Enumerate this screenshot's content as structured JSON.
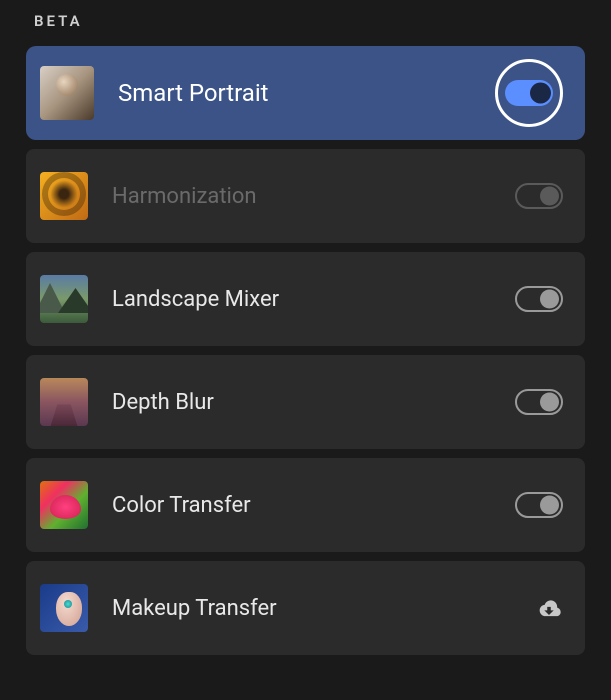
{
  "section": {
    "header": "BETA"
  },
  "filters": [
    {
      "label": "Smart Portrait",
      "active": true,
      "toggle": "on"
    },
    {
      "label": "Harmonization",
      "active": false,
      "disabled": true,
      "toggle": "disabled"
    },
    {
      "label": "Landscape Mixer",
      "active": false,
      "toggle": "off"
    },
    {
      "label": "Depth Blur",
      "active": false,
      "toggle": "off"
    },
    {
      "label": "Color Transfer",
      "active": false,
      "toggle": "off"
    },
    {
      "label": "Makeup Transfer",
      "active": false,
      "toggle": "download"
    }
  ]
}
